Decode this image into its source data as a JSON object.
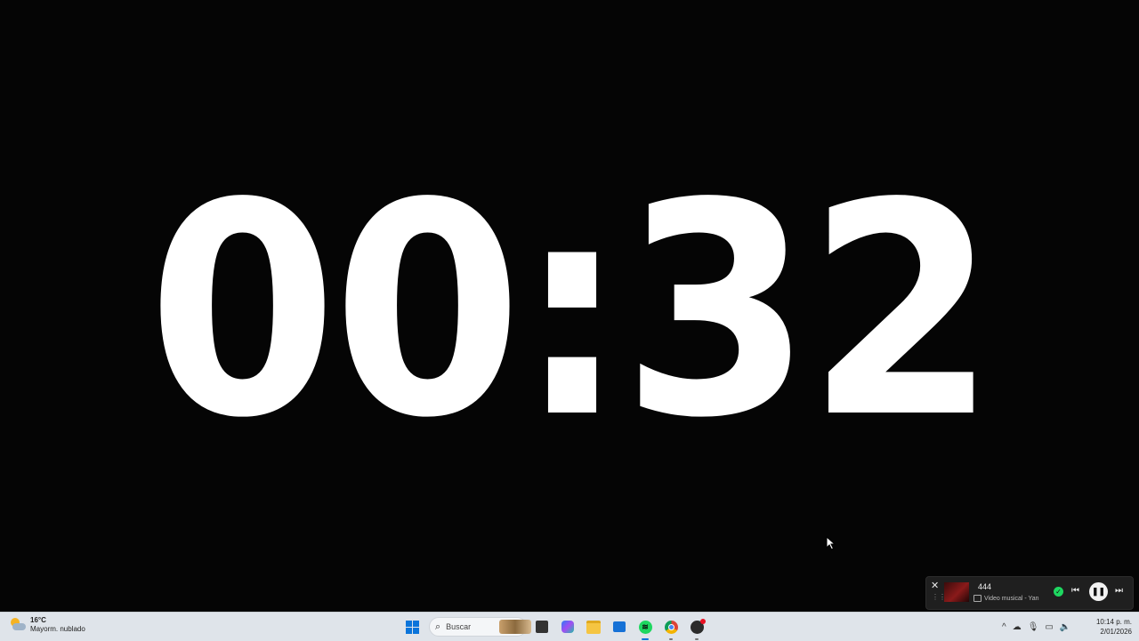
{
  "timer": {
    "display": "00:32"
  },
  "media_player": {
    "title": "444",
    "subtitle": "Video musical - Yan",
    "close_icon": "✕",
    "prev_icon": "⏮",
    "pause_icon": "❚❚",
    "next_icon": "⏭",
    "saved_icon": "✓"
  },
  "taskbar": {
    "weather": {
      "temperature": "16°C",
      "condition": "Mayorm. nublado"
    },
    "search": {
      "placeholder": "Buscar",
      "icon": "⌕"
    },
    "clock": {
      "time": "10:14 p. m.",
      "date": "2/01/2026"
    },
    "tray": {
      "overflow_icon": "^",
      "cloud_icon": "☁",
      "mic_icon": "🎙",
      "display_icon": "▭",
      "volume_icon": "🔈"
    },
    "apps": [
      "start",
      "search",
      "task-view",
      "copilot",
      "file-explorer",
      "microsoft-store",
      "spotify",
      "chrome",
      "app"
    ]
  },
  "colors": {
    "background": "#050505",
    "timer_text": "#ffffff",
    "spotify_green": "#1ed760",
    "accent": "#0a74da"
  }
}
